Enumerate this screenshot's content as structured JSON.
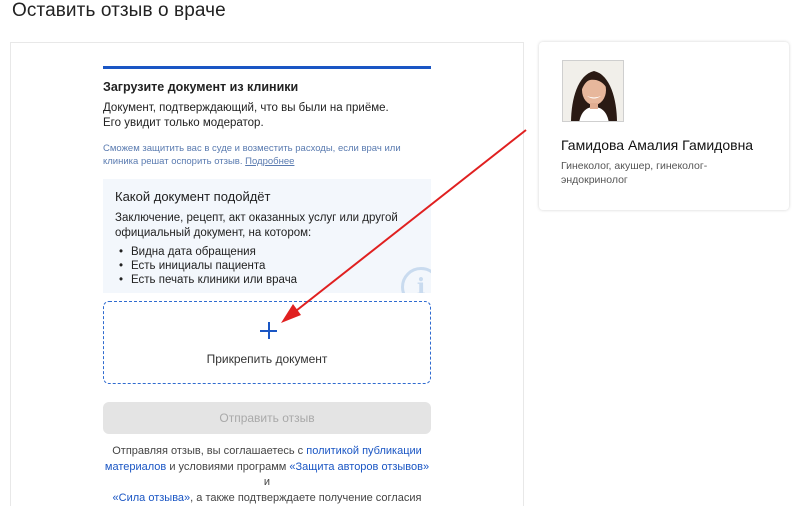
{
  "page": {
    "title": "Оставить отзыв о враче"
  },
  "upload": {
    "title": "Загрузите документ из клиники",
    "desc_line1": "Документ, подтверждающий, что вы были на приёме.",
    "desc_line2": "Его увидит только модератор.",
    "note": "Сможем защитить вас в суде и возместить расходы, если врач или клиника решат оспорить отзыв.",
    "more_link": "Подробнее"
  },
  "hint": {
    "title": "Какой документ подойдёт",
    "text": "Заключение, рецепт, акт оказанных услуг или другой официальный документ, на котором:",
    "items": [
      "Видна дата обращения",
      "Есть инициалы пациента",
      "Есть печать клиники или врача"
    ]
  },
  "attach": {
    "label": "Прикрепить документ"
  },
  "submit": {
    "label": "Отправить отзыв"
  },
  "agreement": {
    "part1": "Отправляя отзыв, вы соглашаетесь с",
    "link1": "политикой публикации материалов",
    "part2": "и условиями программ",
    "link2": "«Защита авторов отзывов»",
    "part3": "и",
    "link3": "«Сила отзыва»",
    "part4": ", а также подтверждаете получение согласия третьих лиц на публикацию их персональных данных"
  },
  "doctor": {
    "name": "Гамидова Амалия Гамидовна",
    "specialty": "Гинеколог, акушер, гинеколог-эндокринолог"
  },
  "colors": {
    "accent": "#1a56c4",
    "annotation_arrow": "#e02020"
  }
}
